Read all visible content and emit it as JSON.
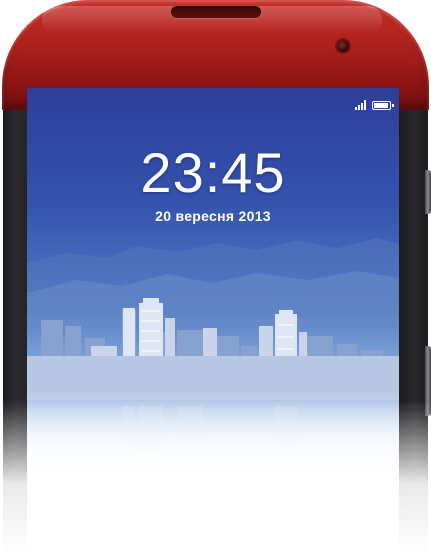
{
  "lock_screen": {
    "time": "23:45",
    "date": "20 вересня 2013"
  },
  "status_bar": {
    "signal_icon": "signal-icon",
    "battery_icon": "battery-icon",
    "battery_level": 0.8
  },
  "device": {
    "body_color": "#b1231f",
    "icons": [
      "speaker-grille-icon",
      "front-camera-icon"
    ]
  },
  "wallpaper": {
    "description_icon": "city-skyline-icon"
  }
}
